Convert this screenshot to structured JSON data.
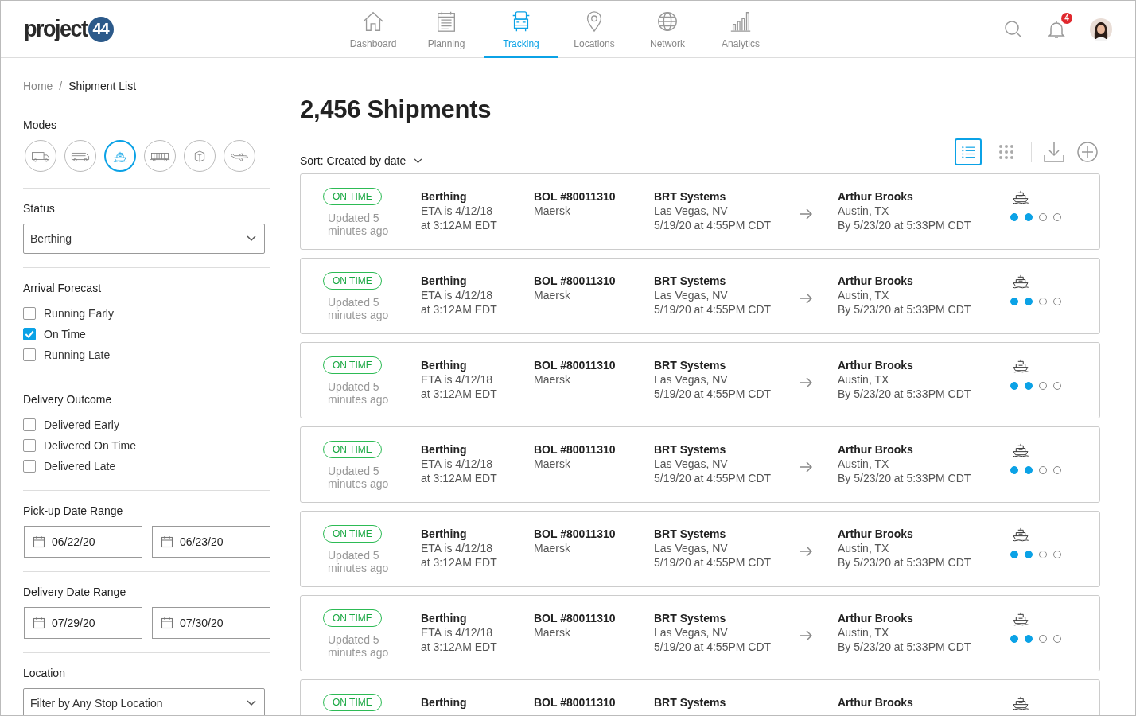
{
  "logo": {
    "text": "project",
    "number": "44"
  },
  "nav": [
    {
      "label": "Dashboard",
      "kind": "house",
      "selected": false
    },
    {
      "label": "Planning",
      "kind": "calendar",
      "selected": false
    },
    {
      "label": "Tracking",
      "kind": "truck",
      "selected": true
    },
    {
      "label": "Locations",
      "kind": "pin",
      "selected": false
    },
    {
      "label": "Network",
      "kind": "globe",
      "selected": false
    },
    {
      "label": "Analytics",
      "kind": "bars",
      "selected": false
    }
  ],
  "notifications": {
    "count": "4"
  },
  "breadcrumb_separator": "/",
  "breadcrumb": [
    {
      "label": "Home",
      "current": false
    },
    {
      "label": "Shipment List",
      "current": true
    }
  ],
  "filters": {
    "modes": {
      "title": "Modes",
      "items": [
        {
          "kind": "truck",
          "selected": false
        },
        {
          "kind": "van",
          "selected": false
        },
        {
          "kind": "ship",
          "selected": true
        },
        {
          "kind": "rail",
          "selected": false
        },
        {
          "kind": "parcel",
          "selected": false
        },
        {
          "kind": "plane",
          "selected": false
        }
      ]
    },
    "status": {
      "title": "Status",
      "value": "Berthing"
    },
    "arrival_forecast": {
      "title": "Arrival Forecast",
      "options": [
        {
          "label": "Running Early",
          "checked": false
        },
        {
          "label": "On Time",
          "checked": true
        },
        {
          "label": "Running Late",
          "checked": false
        }
      ]
    },
    "delivery_outcome": {
      "title": "Delivery Outcome",
      "options": [
        {
          "label": "Delivered Early",
          "checked": false
        },
        {
          "label": "Delivered On Time",
          "checked": false
        },
        {
          "label": "Delivered Late",
          "checked": false
        }
      ]
    },
    "pickup_range": {
      "title": "Pick-up Date Range",
      "from": "06/22/20",
      "to": "06/23/20"
    },
    "delivery_range": {
      "title": "Delivery Date Range",
      "from": "07/29/20",
      "to": "07/30/20"
    },
    "location": {
      "title": "Location",
      "placeholder": "Filter by Any Stop Location"
    }
  },
  "title": "2,456 Shipments",
  "sort": {
    "label": "Sort:",
    "value": "Created by date"
  },
  "view": [
    {
      "kind": "list",
      "selected": true
    },
    {
      "kind": "grid",
      "selected": false
    }
  ],
  "shipments": [
    {
      "status": "ON TIME",
      "updated": "Updated 5 minutes ago",
      "stage": "Berthing",
      "eta": "ETA is 4/12/18",
      "eta_time": "at 3:12AM EDT",
      "bol": "BOL #80011310",
      "carrier": "Maersk",
      "origin": "BRT Systems",
      "origin_city": "Las Vegas, NV",
      "origin_time": "5/19/20 at 4:55PM CDT",
      "dest": "Arthur Brooks",
      "dest_city": "Austin, TX",
      "dest_time": "By 5/23/20 at 5:33PM CDT",
      "steps": [
        {
          "done": true
        },
        {
          "done": true
        },
        {
          "done": false
        },
        {
          "done": false
        }
      ]
    },
    {
      "status": "ON TIME",
      "updated": "Updated 5 minutes ago",
      "stage": "Berthing",
      "eta": "ETA is 4/12/18",
      "eta_time": "at 3:12AM EDT",
      "bol": "BOL #80011310",
      "carrier": "Maersk",
      "origin": "BRT Systems",
      "origin_city": "Las Vegas, NV",
      "origin_time": "5/19/20 at 4:55PM CDT",
      "dest": "Arthur Brooks",
      "dest_city": "Austin, TX",
      "dest_time": "By 5/23/20 at 5:33PM CDT",
      "steps": [
        {
          "done": true
        },
        {
          "done": true
        },
        {
          "done": false
        },
        {
          "done": false
        }
      ]
    },
    {
      "status": "ON TIME",
      "updated": "Updated 5 minutes ago",
      "stage": "Berthing",
      "eta": "ETA is 4/12/18",
      "eta_time": "at 3:12AM EDT",
      "bol": "BOL #80011310",
      "carrier": "Maersk",
      "origin": "BRT Systems",
      "origin_city": "Las Vegas, NV",
      "origin_time": "5/19/20 at 4:55PM CDT",
      "dest": "Arthur Brooks",
      "dest_city": "Austin, TX",
      "dest_time": "By 5/23/20 at 5:33PM CDT",
      "steps": [
        {
          "done": true
        },
        {
          "done": true
        },
        {
          "done": false
        },
        {
          "done": false
        }
      ]
    },
    {
      "status": "ON TIME",
      "updated": "Updated 5 minutes ago",
      "stage": "Berthing",
      "eta": "ETA is 4/12/18",
      "eta_time": "at 3:12AM EDT",
      "bol": "BOL #80011310",
      "carrier": "Maersk",
      "origin": "BRT Systems",
      "origin_city": "Las Vegas, NV",
      "origin_time": "5/19/20 at 4:55PM CDT",
      "dest": "Arthur Brooks",
      "dest_city": "Austin, TX",
      "dest_time": "By 5/23/20 at 5:33PM CDT",
      "steps": [
        {
          "done": true
        },
        {
          "done": true
        },
        {
          "done": false
        },
        {
          "done": false
        }
      ]
    },
    {
      "status": "ON TIME",
      "updated": "Updated 5 minutes ago",
      "stage": "Berthing",
      "eta": "ETA is 4/12/18",
      "eta_time": "at 3:12AM EDT",
      "bol": "BOL #80011310",
      "carrier": "Maersk",
      "origin": "BRT Systems",
      "origin_city": "Las Vegas, NV",
      "origin_time": "5/19/20 at 4:55PM CDT",
      "dest": "Arthur Brooks",
      "dest_city": "Austin, TX",
      "dest_time": "By 5/23/20 at 5:33PM CDT",
      "steps": [
        {
          "done": true
        },
        {
          "done": true
        },
        {
          "done": false
        },
        {
          "done": false
        }
      ]
    },
    {
      "status": "ON TIME",
      "updated": "Updated 5 minutes ago",
      "stage": "Berthing",
      "eta": "ETA is 4/12/18",
      "eta_time": "at 3:12AM EDT",
      "bol": "BOL #80011310",
      "carrier": "Maersk",
      "origin": "BRT Systems",
      "origin_city": "Las Vegas, NV",
      "origin_time": "5/19/20 at 4:55PM CDT",
      "dest": "Arthur Brooks",
      "dest_city": "Austin, TX",
      "dest_time": "By 5/23/20 at 5:33PM CDT",
      "steps": [
        {
          "done": true
        },
        {
          "done": true
        },
        {
          "done": false
        },
        {
          "done": false
        }
      ]
    },
    {
      "status": "ON TIME",
      "stage": "Berthing",
      "bol": "BOL #80011310",
      "origin": "BRT Systems",
      "dest": "Arthur Brooks"
    }
  ]
}
